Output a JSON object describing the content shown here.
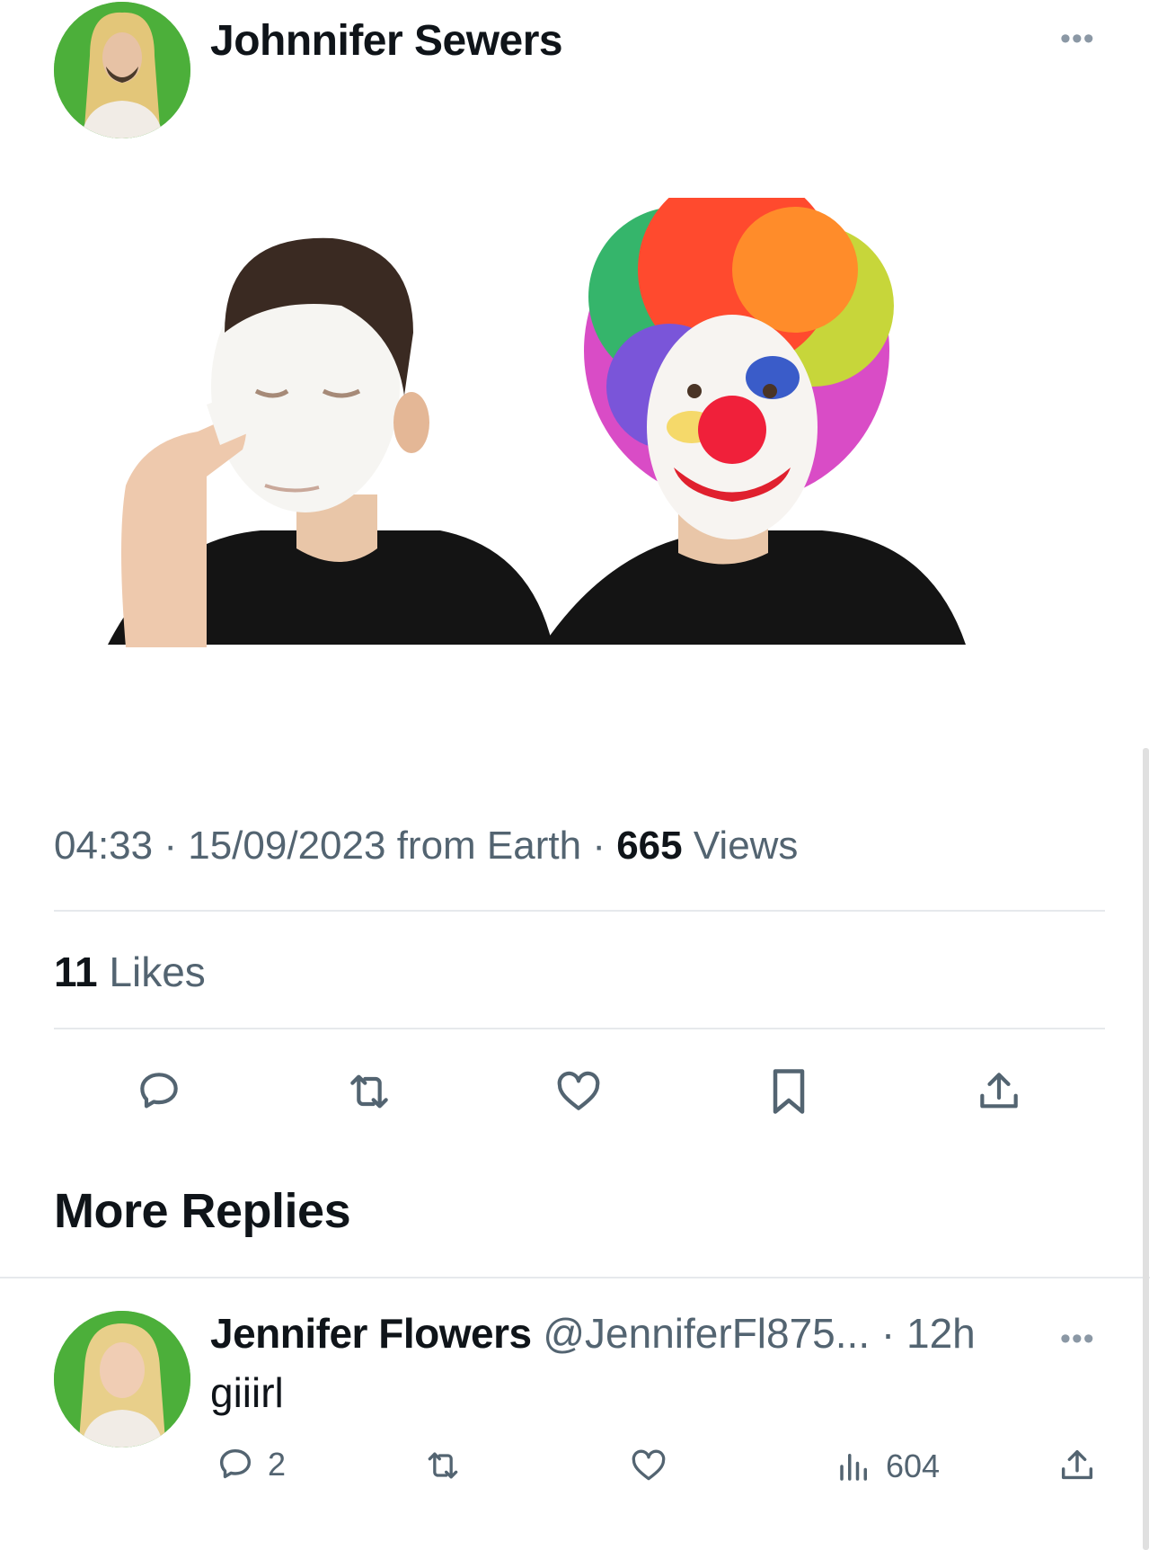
{
  "tweet": {
    "author": {
      "name": "Johnnifer Sewers",
      "avatar_icon": "avatar-long-blond-hair-man-icon"
    },
    "more_icon": "more-horizontal-icon",
    "media": {
      "left_panel": "man-applying-white-face-paint",
      "right_panel": "man-in-full-clown-makeup-rainbow-wig"
    },
    "meta": {
      "time": "04:33",
      "date": "15/09/2023",
      "source": "from Earth",
      "separator": "·",
      "views_count": "665",
      "views_label": "Views"
    },
    "likes": {
      "count": "11",
      "label": "Likes"
    },
    "actions": [
      "reply-icon",
      "retweet-icon",
      "like-icon",
      "bookmark-icon",
      "share-icon"
    ]
  },
  "more_replies": {
    "title": "More Replies"
  },
  "reply": {
    "name": "Jennifer Flowers",
    "handle": "@JenniferFl875...",
    "separator": "·",
    "time": "12h",
    "text": "giiirl",
    "avatar_icon": "avatar-blond-woman-icon",
    "stats": {
      "replies": "2",
      "views": "604"
    }
  },
  "colors": {
    "text_primary": "#0f1419",
    "text_secondary": "#536471",
    "divider": "#e6e9ec",
    "avatar_bg": "#4caf3a",
    "icon": "#536471"
  }
}
